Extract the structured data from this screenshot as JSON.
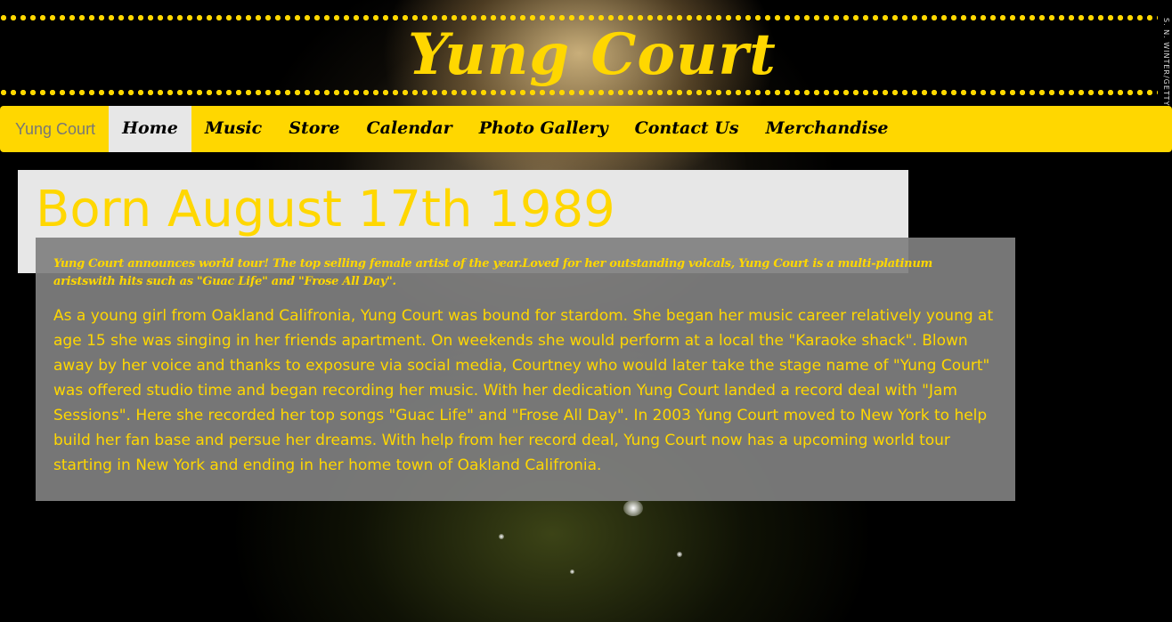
{
  "header": {
    "site_title": "Yung Court"
  },
  "photo_credit": "S. N. WINTER/GETTY IMAGES",
  "nav": {
    "brand": "Yung Court",
    "items": [
      {
        "label": "Home",
        "active": true
      },
      {
        "label": "Music",
        "active": false
      },
      {
        "label": "Store",
        "active": false
      },
      {
        "label": "Calendar",
        "active": false
      },
      {
        "label": "Photo Gallery",
        "active": false
      },
      {
        "label": "Contact Us",
        "active": false
      },
      {
        "label": "Merchandise",
        "active": false
      }
    ]
  },
  "jumbotron": {
    "heading": "Born August 17th 1989"
  },
  "content": {
    "lead": "Yung Court announces world tour! The top selling female artist of the year.Loved for her outstanding volcals, Yung Court is a multi-platinum aristswith hits such as \"Guac Life\" and \"Frose All Day\".",
    "body": "As a young girl from Oakland Califronia, Yung Court was bound for stardom. She began her music career relatively young at age 15 she was singing in her friends apartment. On weekends she would perform at a local the \"Karaoke shack\". Blown away by her voice and thanks to exposure via social media, Courtney who would later take the stage name of \"Yung Court\" was offered studio time and began recording her music. With her dedication Yung Court landed a record deal with \"Jam Sessions\". Here she recorded her top songs \"Guac Life\" and \"Frose All Day\". In 2003 Yung Court moved to New York to help build her fan base and persue her dreams. With help from her record deal, Yung Court now has a upcoming world tour starting in New York and ending in her home town of Oakland Califronia."
  },
  "colors": {
    "accent": "#ffd700",
    "nav_active_bg": "#e7e7e7",
    "panel_bg": "#808080",
    "page_bg": "#000000"
  }
}
